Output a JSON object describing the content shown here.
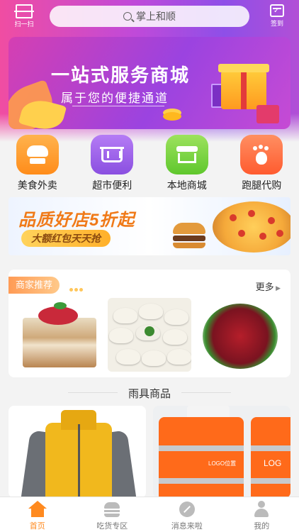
{
  "topbar": {
    "scan_label": "扫一扫",
    "search_placeholder": "掌上和顺",
    "checkin_label": "签到"
  },
  "banner": {
    "title": "一站式服务商城",
    "subtitle": "属于您的便捷通道"
  },
  "categories": [
    {
      "label": "美食外卖",
      "icon": "chef-hat-icon",
      "color": "#ff9c2a"
    },
    {
      "label": "超市便利",
      "icon": "basket-icon",
      "color": "#9b5cea"
    },
    {
      "label": "本地商城",
      "icon": "shop-icon",
      "color": "#72d03b"
    },
    {
      "label": "跑腿代购",
      "icon": "footprint-icon",
      "color": "#ff6b3d"
    }
  ],
  "promo": {
    "title": "品质好店5折起",
    "tagline": "大额红包天天抢"
  },
  "merchant": {
    "tag": "商家推荐",
    "more": "更多",
    "thumbs": [
      "cake-image",
      "dumplings-image",
      "beef-image"
    ]
  },
  "products_section": {
    "title": "雨具商品",
    "items": [
      "yellow-jacket-image",
      "orange-vest-image"
    ],
    "vest_logo_text": "LOGO位置",
    "vest_logo_text2": "LOG"
  },
  "tabbar": {
    "tabs": [
      {
        "label": "首页",
        "active": true
      },
      {
        "label": "吃货专区",
        "active": false
      },
      {
        "label": "消息来啦",
        "active": false
      },
      {
        "label": "我的",
        "active": false
      }
    ]
  },
  "colors": {
    "accent": "#ff8a1f",
    "header_gradient_start": "#f04da2",
    "header_gradient_end": "#8e4fe8"
  }
}
